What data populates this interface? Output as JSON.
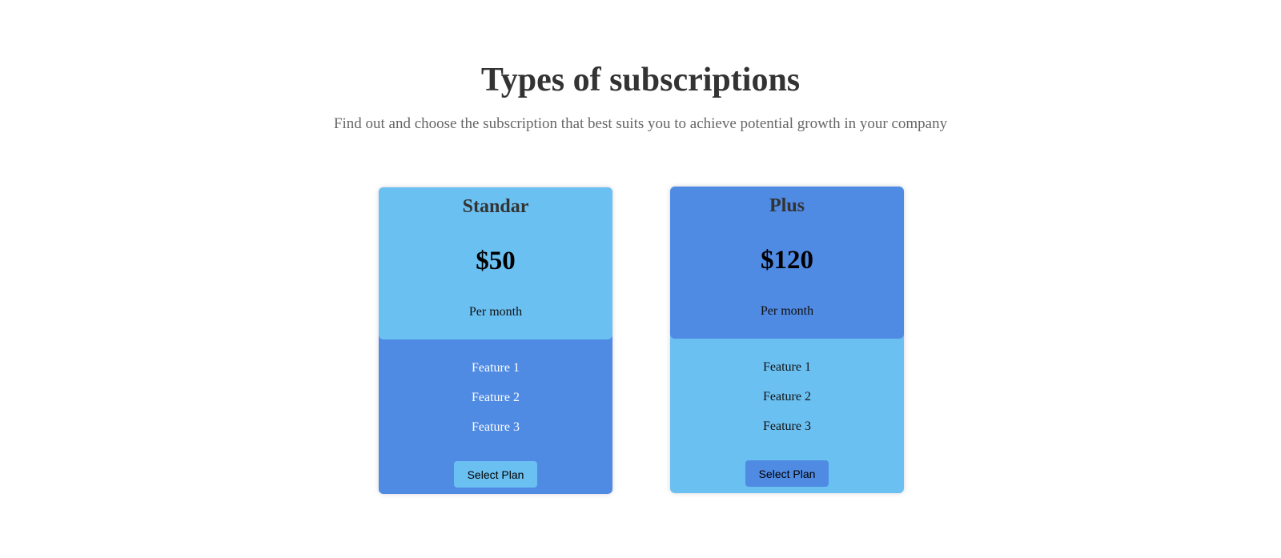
{
  "header": {
    "title": "Types of subscriptions",
    "subtitle": "Find out and choose the subscription that best suits you to achieve potential growth in your company"
  },
  "plans": [
    {
      "name": "Standar",
      "price": "$50",
      "period": "Per month",
      "features": [
        "Feature 1",
        "Feature 2",
        "Feature 3"
      ],
      "button_label": "Select Plan"
    },
    {
      "name": "Plus",
      "price": "$120",
      "period": "Per month",
      "features": [
        "Feature 1",
        "Feature 2",
        "Feature 3"
      ],
      "button_label": "Select Plan"
    }
  ],
  "colors": {
    "light_blue": "#6bc0f2",
    "dark_blue": "#4f8ae3",
    "title_text": "#333333",
    "subtitle_text": "#666666"
  }
}
